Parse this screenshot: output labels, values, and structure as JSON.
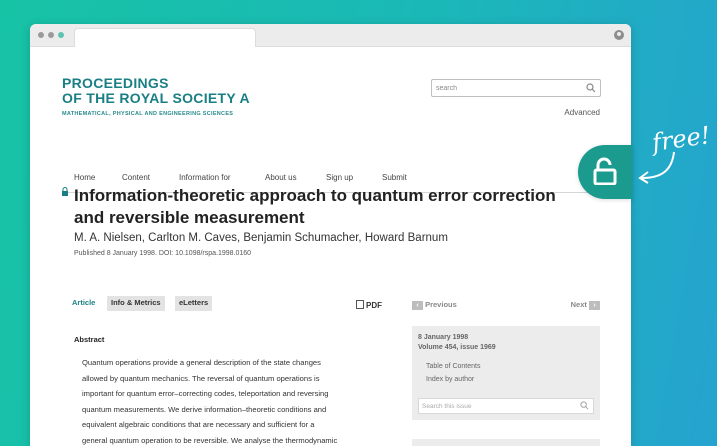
{
  "journal": {
    "name_line1": "PROCEEDINGS",
    "name_line2": "OF THE ROYAL SOCIETY A",
    "subtitle": "MATHEMATICAL, PHYSICAL AND ENGINEERING SCIENCES"
  },
  "search": {
    "placeholder": "search",
    "advanced_label": "Advanced"
  },
  "nav": [
    "Home",
    "Content",
    "Information for",
    "About us",
    "Sign up",
    "Submit"
  ],
  "article": {
    "title": "Information-theoretic approach to quantum error correction and reversible measurement",
    "authors": "M. A. Nielsen, Carlton M. Caves, Benjamin Schumacher, Howard Barnum",
    "published": "Published 8 January 1998. DOI: 10.1098/rspa.1998.0160"
  },
  "tabs": [
    "Article",
    "Info & Metrics",
    "eLetters"
  ],
  "pdf_label": "PDF",
  "abstract": {
    "heading": "Abstract",
    "lines": [
      "Quantum operations provide a general description of the state changes",
      "allowed by quantum mechanics. The reversal of quantum operations is",
      "important for quantum error–correcting codes, teleportation and reversing",
      "quantum measurements. We derive information–theoretic conditions and",
      "equivalent algebraic conditions that are necessary and sufficient for a",
      "general quantum operation to be reversible. We analyse the thermodynamic"
    ]
  },
  "pager": {
    "previous": "Previous",
    "next": "Next"
  },
  "issue": {
    "date": "8 January 1998",
    "volume": "Volume 454, issue 1969",
    "toc": "Table of Contents",
    "index": "Index by author",
    "search_placeholder": "Search this issue"
  },
  "overlay": {
    "free_text": "free!"
  },
  "colors": {
    "brand_teal": "#1a7f84",
    "badge_green": "#1b9b8e",
    "bg_gradient_start": "#17c3a5",
    "bg_gradient_end": "#25a3cf"
  }
}
